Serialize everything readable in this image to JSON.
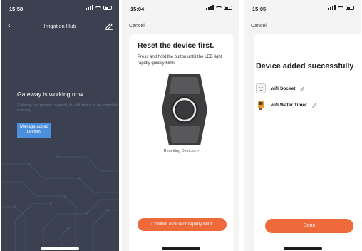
{
  "colors": {
    "dark_bg": "#3b4150",
    "accent_blue": "#4c8fdc",
    "accent_orange": "#ef6a3a",
    "light_bg": "#f4f4f4"
  },
  "panel1": {
    "status_time": "15:58",
    "header": {
      "back_icon": "chevron-left-icon",
      "title": "Irrigation Hub",
      "edit_icon": "pencil-icon"
    },
    "heading": "Gateway is working now",
    "subtitle": "Gateway can provide capability for wifi device to be controlled remotely.",
    "manage_button": "Manage added devices"
  },
  "panel2": {
    "status_time": "15:04",
    "cancel_label": "Cancel",
    "title": "Reset the device first.",
    "description": "Press and hold the button untill the LED light rapidly quickly blink",
    "resetting_link": "Resetting Devices >",
    "confirm_button": "Confirm indicator rapidly blink"
  },
  "panel3": {
    "status_time": "15:05",
    "cancel_label": "Cancel",
    "title": "Device added successfully",
    "devices": [
      {
        "name": "wifi Socket",
        "icon": "socket-icon"
      },
      {
        "name": "wifi Water Timer",
        "icon": "water-timer-icon"
      }
    ],
    "done_button": "Done"
  }
}
